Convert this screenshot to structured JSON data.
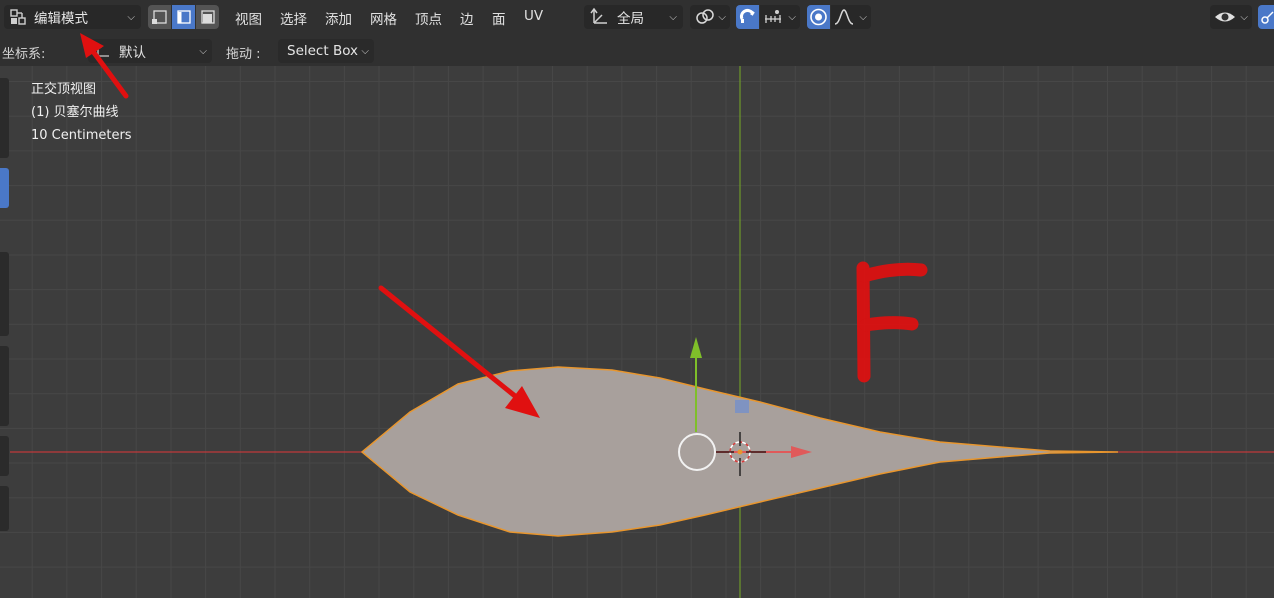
{
  "header": {
    "mode_label": "编辑模式",
    "menus": [
      {
        "id": "menu-view",
        "label": "视图"
      },
      {
        "id": "menu-select",
        "label": "选择"
      },
      {
        "id": "menu-add",
        "label": "添加"
      },
      {
        "id": "menu-mesh",
        "label": "网格"
      },
      {
        "id": "menu-vertex",
        "label": "顶点"
      },
      {
        "id": "menu-edge",
        "label": "边"
      },
      {
        "id": "menu-face",
        "label": "面"
      },
      {
        "id": "menu-uv",
        "label": "UV"
      }
    ],
    "transform_orientation": "全局",
    "select_mode_active": "edge"
  },
  "toolrow": {
    "coord_label": "坐标系:",
    "coord_value": "默认",
    "drag_label": "拖动 :",
    "drag_value": "Select Box"
  },
  "viewport": {
    "view_name": "正交顶视图",
    "object_name": "(1) 贝塞尔曲线",
    "scale_text": "10 Centimeters",
    "annotation_letter": "F"
  },
  "colors": {
    "shape_fill": "#a8a09c",
    "shape_outline": "#e8962e",
    "x_axis": "#c0393b",
    "y_axis": "#6e9a2a",
    "annotation": "#e01010",
    "active_blue": "#4a78c8"
  }
}
